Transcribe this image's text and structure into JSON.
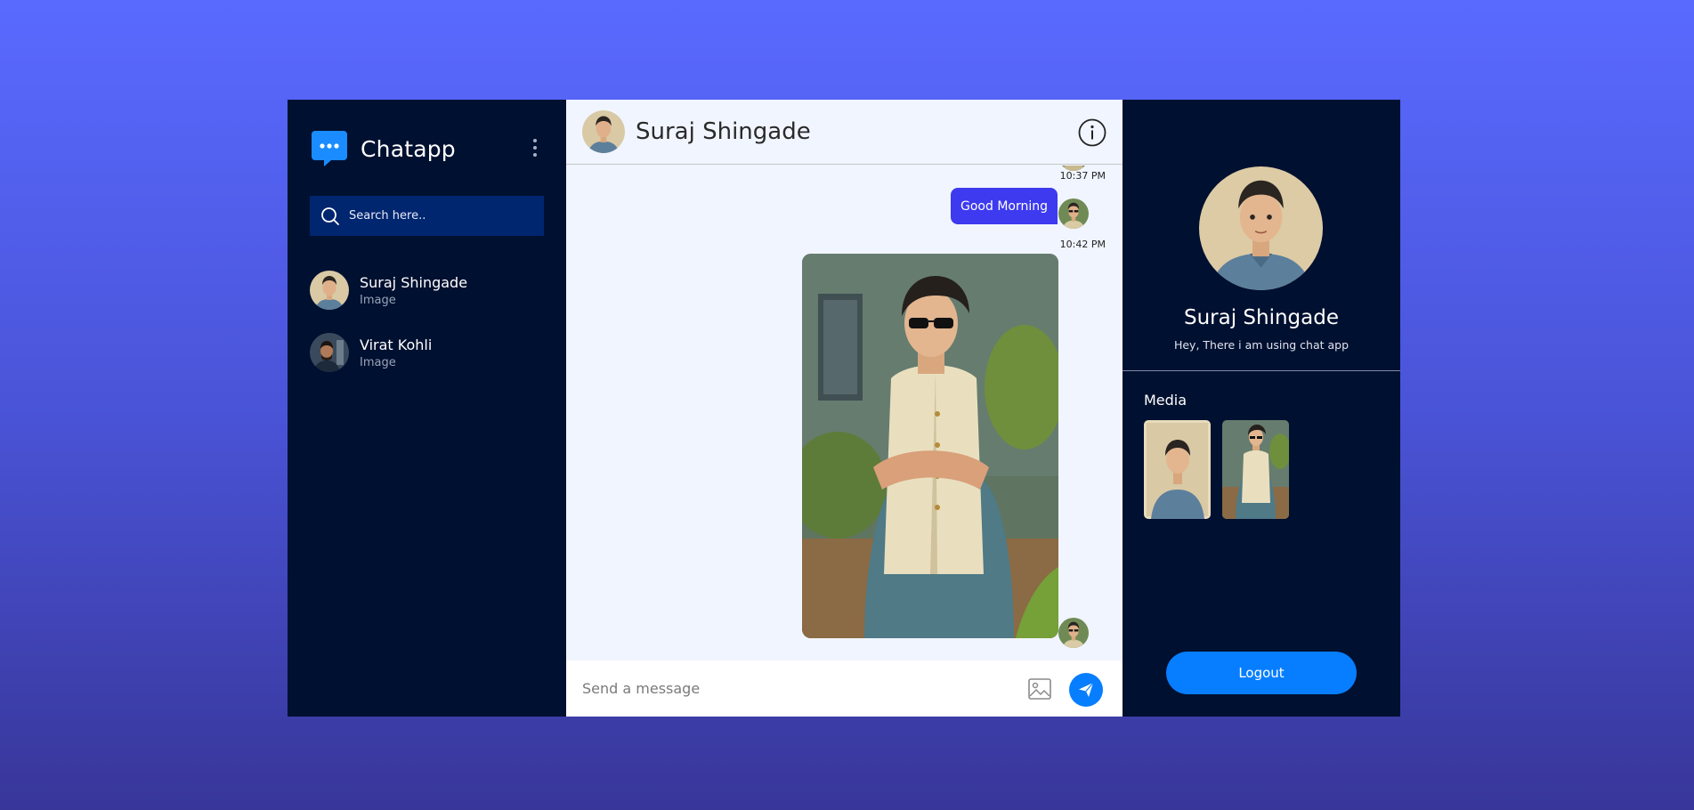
{
  "app": {
    "name": "Chatapp",
    "logo_icon": "chat-bubble-icon",
    "menu_icon": "vertical-dots-icon",
    "accent": "#077eff",
    "sidebar_bg": "#001030"
  },
  "search": {
    "placeholder": "Search here..",
    "icon": "search-icon"
  },
  "contacts": [
    {
      "name": "Suraj Shingade",
      "last_message": "Image"
    },
    {
      "name": "Virat Kohli",
      "last_message": "Image"
    }
  ],
  "chat": {
    "title": "Suraj Shingade",
    "info_icon": "info-icon",
    "messages": [
      {
        "type": "time",
        "time": "10:37 PM"
      },
      {
        "type": "text",
        "text": "Good Morning",
        "time": "10:42 PM"
      },
      {
        "type": "image",
        "alt": "Illustration of man in sunglasses and vest"
      }
    ],
    "input": {
      "placeholder": "Send a message",
      "gallery_icon": "image-upload-icon",
      "send_icon": "send-arrow-icon"
    }
  },
  "profile": {
    "name": "Suraj Shingade",
    "bio": "Hey, There i am using chat app",
    "media_label": "Media",
    "logout_label": "Logout"
  }
}
